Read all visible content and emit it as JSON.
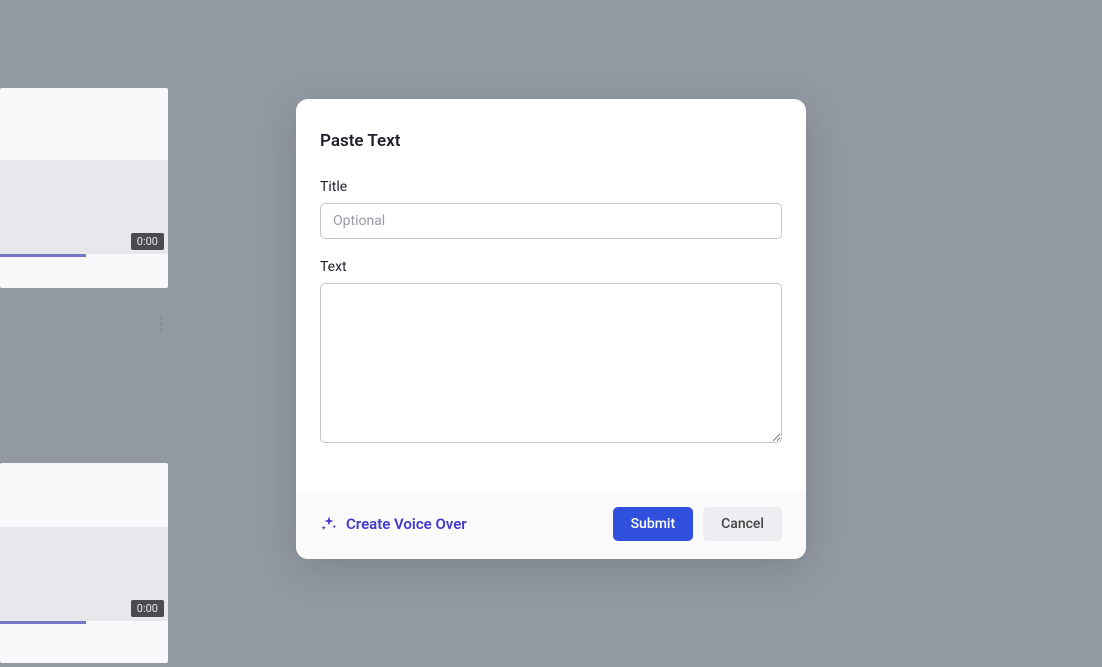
{
  "modal": {
    "title": "Paste Text",
    "fields": {
      "title": {
        "label": "Title",
        "placeholder": "Optional",
        "value": ""
      },
      "text": {
        "label": "Text",
        "value": ""
      }
    },
    "footer": {
      "voice_over_label": "Create Voice Over",
      "submit_label": "Submit",
      "cancel_label": "Cancel"
    }
  },
  "background": {
    "video_1_duration": "0:00",
    "video_2_duration": "0:00"
  }
}
